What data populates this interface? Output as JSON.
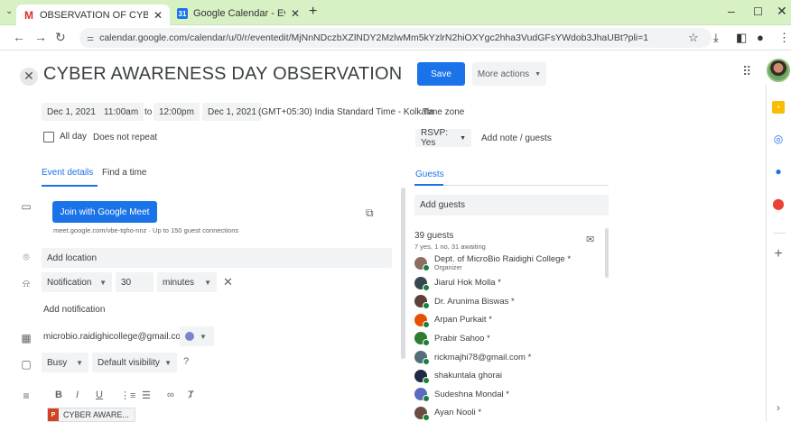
{
  "browser": {
    "tabs": [
      {
        "label": "OBSERVATION OF CYBER AWA",
        "icon": "gmail-icon",
        "active": true
      },
      {
        "label": "Google Calendar - Event details",
        "icon": "calendar-icon",
        "active": false
      }
    ],
    "tab_close": "✕",
    "new_tab": "+",
    "url": "calendar.google.com/calendar/u/0/r/eventedit/MjNnNDczbXZlNDY2MzlwMm5kYzlrN2hiOXYgc2hha3VudGFsYWdob3JhaUBt?pli=1",
    "minimize": "–",
    "maximize": "☐",
    "close": "✕"
  },
  "event": {
    "title": "CYBER AWARENESS DAY OBSERVATION",
    "close_symbol": "✕",
    "save_label": "Save",
    "more_actions_label": "More actions",
    "start_date": "Dec 1, 2021",
    "start_time": "11:00am",
    "to_label": "to",
    "end_time": "12:00pm",
    "end_date": "Dec 1, 2021",
    "timezone": "(GMT+05:30) India Standard Time - Kolkata",
    "timezone_link": "Time zone",
    "all_day_label": "All day",
    "repeat_label": "Does not repeat",
    "rsvp_label": "RSVP: Yes",
    "add_note_label": "Add note / guests"
  },
  "details": {
    "tab_event_details": "Event details",
    "tab_find_time": "Find a time",
    "meet_button": "Join with Google Meet",
    "meet_link": "meet.google.com/vbe-tqho-nnz · Up to 150 guest connections",
    "location_placeholder": "Add location",
    "notification_type": "Notification",
    "notification_value": "30",
    "notification_unit": "minutes",
    "add_notification": "Add notification",
    "calendar_owner": "microbio.raidighicollege@gmail.com",
    "busy": "Busy",
    "visibility": "Default visibility",
    "attachment": "CYBER AWARE..."
  },
  "guests": {
    "header": "Guests",
    "add_placeholder": "Add guests",
    "count": "39 guests",
    "summary": "7 yes, 1 no, 31 awaiting",
    "list": [
      {
        "name": "Dept. of MicroBio Raidighi College *",
        "sub": "Organizer",
        "color": "#8d6e63"
      },
      {
        "name": "Jiarul Hok Molla *",
        "sub": "",
        "color": "#37474f"
      },
      {
        "name": "Dr. Arunima Biswas *",
        "sub": "",
        "color": "#5d4037"
      },
      {
        "name": "Arpan Purkait *",
        "sub": "",
        "color": "#e65100"
      },
      {
        "name": "Prabir Sahoo *",
        "sub": "",
        "color": "#2e7d32"
      },
      {
        "name": "rickmajhi78@gmail.com *",
        "sub": "",
        "color": "#546e7a"
      },
      {
        "name": "shakuntala ghorai",
        "sub": "",
        "color": "#1f2a44"
      },
      {
        "name": "Sudeshna Mondal *",
        "sub": "",
        "color": "#5c6bc0"
      },
      {
        "name": "Ayan Nooli *",
        "sub": "",
        "color": "#6d4c41"
      }
    ]
  },
  "colors": {
    "accent": "#1a73e8",
    "tabstrip": "#d7f1c5",
    "field_bg": "#f1f3f4"
  }
}
